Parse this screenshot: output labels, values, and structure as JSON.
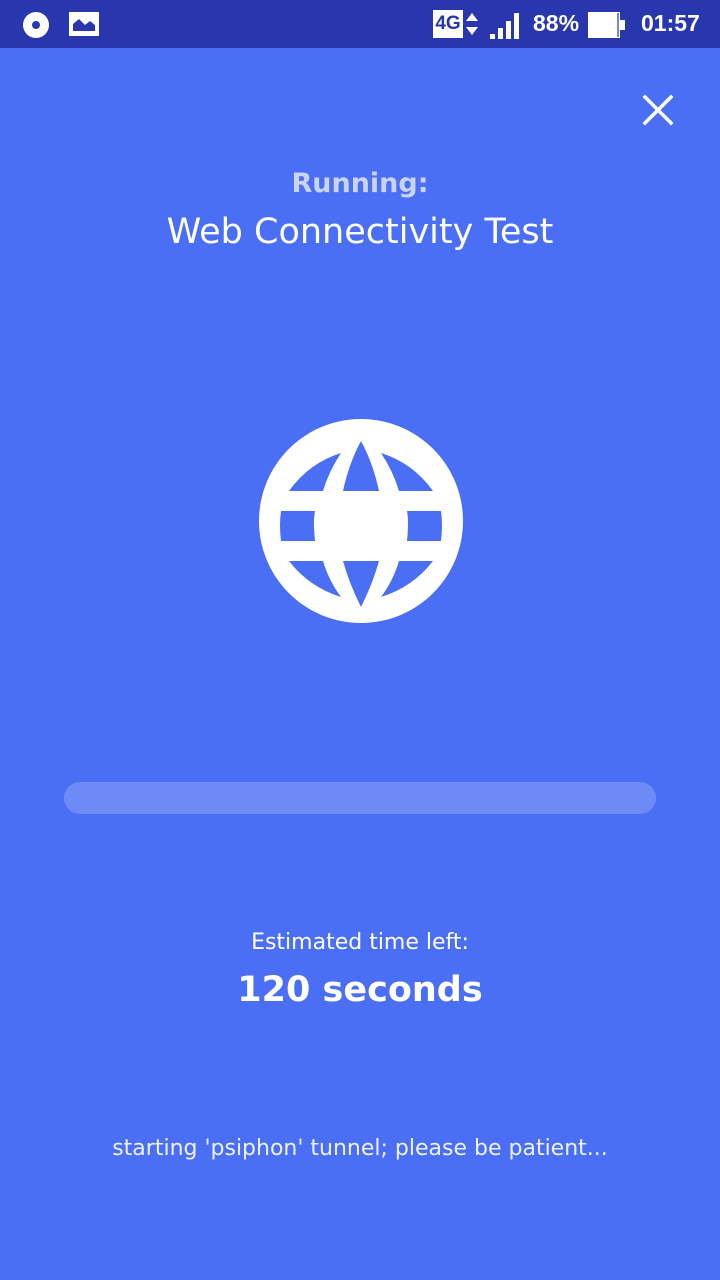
{
  "status_bar": {
    "left_icons": [
      "sync-circle-icon",
      "image-icon"
    ],
    "network_type": "4G",
    "data_activity_icon": "up-down-arrows-icon",
    "signal_icon": "signal-bars-icon",
    "battery_percent": "88%",
    "battery_icon": "battery-icon",
    "time": "01:57"
  },
  "header": {
    "close_icon": "close-icon",
    "running_label": "Running:",
    "test_name": "Web Connectivity Test"
  },
  "test_icon": "globe-icon",
  "progress": {
    "fraction": 0
  },
  "eta": {
    "label": "Estimated time left:",
    "value": "120 seconds"
  },
  "log": {
    "message": "starting 'psiphon' tunnel; please be patient..."
  },
  "colors": {
    "background": "#4a6ff4",
    "status_bar": "#2937ae",
    "progress_track": "#6e8bf5",
    "running_label": "#c9d3f2"
  }
}
